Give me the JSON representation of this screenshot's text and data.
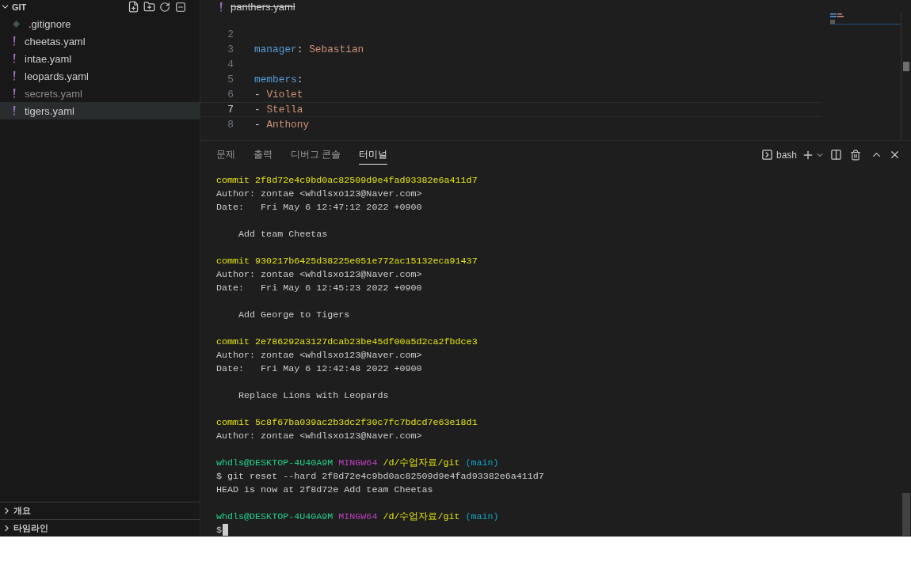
{
  "explorer": {
    "title": "GIT",
    "expanded": true,
    "files": [
      {
        "name": ".gitignore",
        "kind": "gitignore",
        "dimmed": false,
        "selected": false
      },
      {
        "name": "cheetas.yaml",
        "kind": "yaml",
        "dimmed": false,
        "selected": false
      },
      {
        "name": "intae.yaml",
        "kind": "yaml",
        "dimmed": false,
        "selected": false
      },
      {
        "name": "leopards.yaml",
        "kind": "yaml",
        "dimmed": false,
        "selected": false
      },
      {
        "name": "secrets.yaml",
        "kind": "yaml",
        "dimmed": true,
        "selected": false
      },
      {
        "name": "tigers.yaml",
        "kind": "yaml",
        "dimmed": false,
        "selected": true
      }
    ],
    "sections": [
      {
        "label": "개요",
        "expanded": false
      },
      {
        "label": "타임라인",
        "expanded": false
      }
    ]
  },
  "editor": {
    "tab": {
      "name": "panthers.yaml",
      "deleted": true
    },
    "lines": [
      {
        "number": "2",
        "active": false
      },
      {
        "number": "3",
        "active": false,
        "key": "manager",
        "sep": ":",
        "value": "Sebastian"
      },
      {
        "number": "4",
        "active": false
      },
      {
        "number": "5",
        "active": false,
        "key": "members",
        "sep": ":"
      },
      {
        "number": "6",
        "active": false,
        "dash": "-",
        "value": "Violet"
      },
      {
        "number": "7",
        "active": true,
        "dash": "-",
        "value": "Stella"
      },
      {
        "number": "8",
        "active": false,
        "dash": "-",
        "value": "Anthony"
      }
    ]
  },
  "panel": {
    "tabs": [
      {
        "label": "문제",
        "selected": false
      },
      {
        "label": "출력",
        "selected": false
      },
      {
        "label": "디버그 콘솔",
        "selected": false
      },
      {
        "label": "터미널",
        "selected": true
      }
    ],
    "shell": "bash",
    "lines": [
      {
        "kind": "text",
        "segments": [
          {
            "text": "commit 2f8d72e4c9bd0ac82509d9e4fad93382e6a411d7",
            "kind": "yellow"
          }
        ]
      },
      {
        "kind": "text",
        "segments": [
          {
            "text": "Author: zontae <whdlsxo123@Naver.com>",
            "kind": "plain"
          }
        ]
      },
      {
        "kind": "text",
        "segments": [
          {
            "text": "Date:   Fri May 6 12:47:12 2022 +0900",
            "kind": "plain"
          }
        ]
      },
      {
        "kind": "blank"
      },
      {
        "kind": "text",
        "segments": [
          {
            "text": "    Add team Cheetas",
            "kind": "plain"
          }
        ]
      },
      {
        "kind": "blank"
      },
      {
        "kind": "text",
        "segments": [
          {
            "text": "commit 930217b6425d38225e051e772ac15132eca91437",
            "kind": "yellow"
          }
        ]
      },
      {
        "kind": "text",
        "segments": [
          {
            "text": "Author: zontae <whdlsxo123@Naver.com>",
            "kind": "plain"
          }
        ]
      },
      {
        "kind": "text",
        "segments": [
          {
            "text": "Date:   Fri May 6 12:45:23 2022 +0900",
            "kind": "plain"
          }
        ]
      },
      {
        "kind": "blank"
      },
      {
        "kind": "text",
        "segments": [
          {
            "text": "    Add George to Tigers",
            "kind": "plain"
          }
        ]
      },
      {
        "kind": "blank"
      },
      {
        "kind": "text",
        "segments": [
          {
            "text": "commit 2e786292a3127dcab23be45df00a5d2ca2fbdce3",
            "kind": "yellow"
          }
        ]
      },
      {
        "kind": "text",
        "segments": [
          {
            "text": "Author: zontae <whdlsxo123@Naver.com>",
            "kind": "plain"
          }
        ]
      },
      {
        "kind": "text",
        "segments": [
          {
            "text": "Date:   Fri May 6 12:42:48 2022 +0900",
            "kind": "plain"
          }
        ]
      },
      {
        "kind": "blank"
      },
      {
        "kind": "text",
        "segments": [
          {
            "text": "    Replace Lions with Leopards",
            "kind": "plain"
          }
        ]
      },
      {
        "kind": "blank"
      },
      {
        "kind": "text",
        "segments": [
          {
            "text": "commit 5c8f67ba039ac2b3dc2f30c7fc7bdcd7e63e18d1",
            "kind": "yellow"
          }
        ]
      },
      {
        "kind": "text",
        "segments": [
          {
            "text": "Author: zontae <whdlsxo123@Naver.com>",
            "kind": "plain"
          }
        ]
      },
      {
        "kind": "blank"
      },
      {
        "kind": "text",
        "segments": [
          {
            "text": "whdls@DESKTOP-4U40A9M",
            "kind": "green"
          },
          {
            "text": "MINGW64",
            "kind": "magenta"
          },
          {
            "text": "/d/수업자료/git",
            "kind": "yellow"
          },
          {
            "text": "(main)",
            "kind": "cyan"
          }
        ]
      },
      {
        "kind": "text",
        "segments": [
          {
            "text": "$ git reset --hard 2f8d72e4c9bd0ac82509d9e4fad93382e6a411d7",
            "kind": "plain"
          }
        ]
      },
      {
        "kind": "text",
        "segments": [
          {
            "text": "HEAD is now at 2f8d72e Add team Cheetas",
            "kind": "plain"
          }
        ]
      },
      {
        "kind": "blank"
      },
      {
        "kind": "text",
        "segments": [
          {
            "text": "whdls@DESKTOP-4U40A9M",
            "kind": "green"
          },
          {
            "text": "MINGW64",
            "kind": "magenta"
          },
          {
            "text": "/d/수업자료/git",
            "kind": "yellow"
          },
          {
            "text": "(main)",
            "kind": "cyan"
          }
        ]
      },
      {
        "kind": "cursor",
        "segments": [
          {
            "text": "$",
            "kind": "plain"
          }
        ]
      }
    ]
  }
}
